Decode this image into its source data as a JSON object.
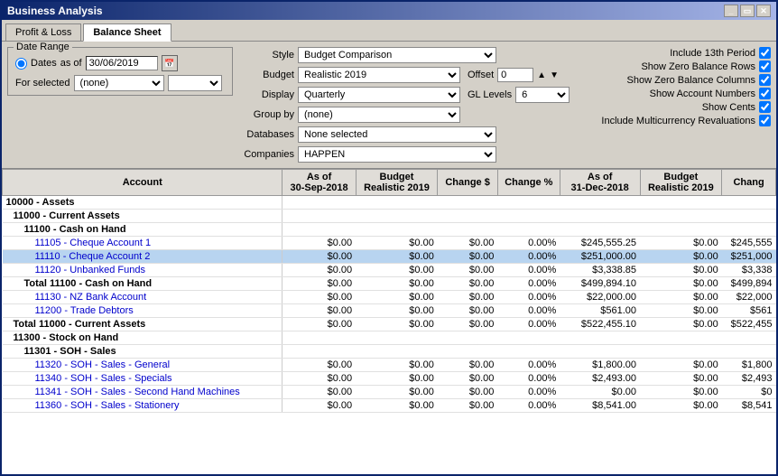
{
  "window": {
    "title": "Business Analysis"
  },
  "tabs": [
    {
      "label": "Profit & Loss",
      "active": false
    },
    {
      "label": "Balance Sheet",
      "active": true
    }
  ],
  "controls": {
    "dateRange": {
      "legend": "Date Range",
      "radioLabel": "Dates",
      "asOfLabel": "as of",
      "dateValue": "30/06/2019",
      "forSelectedLabel": "For selected",
      "forSelectedOption": "(none)"
    },
    "style": {
      "label": "Style",
      "value": "Budget Comparison"
    },
    "budget": {
      "label": "Budget",
      "value": "Realistic 2019"
    },
    "offset": {
      "label": "Offset",
      "value": "0"
    },
    "display": {
      "label": "Display",
      "value": "Quarterly"
    },
    "glLevels": {
      "label": "GL Levels",
      "value": "6"
    },
    "groupBy": {
      "label": "Group by",
      "value": "(none)"
    },
    "databases": {
      "label": "Databases",
      "value": "None selected"
    },
    "companies": {
      "label": "Companies",
      "value": "HAPPEN"
    }
  },
  "checkboxes": [
    {
      "label": "Include 13th Period",
      "checked": true
    },
    {
      "label": "Show Zero Balance Rows",
      "checked": true
    },
    {
      "label": "Show Zero Balance Columns",
      "checked": true
    },
    {
      "label": "Show Account Numbers",
      "checked": true
    },
    {
      "label": "Show Cents",
      "checked": true
    },
    {
      "label": "Include Multicurrency Revaluations",
      "checked": true
    }
  ],
  "table": {
    "col1Header": "Account",
    "columns": [
      {
        "header": "As of\n30-Sep-2018"
      },
      {
        "header": "Budget\nRealistic 2019"
      },
      {
        "header": "Change $"
      },
      {
        "header": "Change %"
      },
      {
        "header": "As of\n31-Dec-2018"
      },
      {
        "header": "Budget\nRealistic 2019"
      },
      {
        "header": "Chang"
      }
    ],
    "rows": [
      {
        "account": "10000 - Assets",
        "indent": 0,
        "bold": true,
        "values": [
          "",
          "",
          "",
          "",
          "",
          "",
          ""
        ]
      },
      {
        "account": "11000 - Current Assets",
        "indent": 1,
        "bold": true,
        "values": [
          "",
          "",
          "",
          "",
          "",
          "",
          ""
        ]
      },
      {
        "account": "11100 - Cash on Hand",
        "indent": 2,
        "bold": true,
        "values": [
          "",
          "",
          "",
          "",
          "",
          "",
          ""
        ]
      },
      {
        "account": "11105 - Cheque Account 1",
        "indent": 3,
        "bold": false,
        "link": true,
        "values": [
          "$0.00",
          "$0.00",
          "$0.00",
          "0.00%",
          "$245,555.25",
          "$0.00",
          "$245,555"
        ]
      },
      {
        "account": "11110 - Cheque Account 2",
        "indent": 3,
        "bold": false,
        "link": true,
        "highlight": true,
        "values": [
          "$0.00",
          "$0.00",
          "$0.00",
          "0.00%",
          "$251,000.00",
          "$0.00",
          "$251,000"
        ]
      },
      {
        "account": "11120 - Unbanked Funds",
        "indent": 3,
        "bold": false,
        "link": true,
        "values": [
          "$0.00",
          "$0.00",
          "$0.00",
          "0.00%",
          "$3,338.85",
          "$0.00",
          "$3,338"
        ]
      },
      {
        "account": "Total 11100 - Cash on Hand",
        "indent": 2,
        "bold": true,
        "values": [
          "$0.00",
          "$0.00",
          "$0.00",
          "0.00%",
          "$499,894.10",
          "$0.00",
          "$499,894"
        ]
      },
      {
        "account": "11130 - NZ Bank Account",
        "indent": 3,
        "bold": false,
        "link": true,
        "values": [
          "$0.00",
          "$0.00",
          "$0.00",
          "0.00%",
          "$22,000.00",
          "$0.00",
          "$22,000"
        ]
      },
      {
        "account": "11200 - Trade Debtors",
        "indent": 3,
        "bold": false,
        "link": true,
        "values": [
          "$0.00",
          "$0.00",
          "$0.00",
          "0.00%",
          "$561.00",
          "$0.00",
          "$561"
        ]
      },
      {
        "account": "Total 11000 - Current Assets",
        "indent": 1,
        "bold": true,
        "values": [
          "$0.00",
          "$0.00",
          "$0.00",
          "0.00%",
          "$522,455.10",
          "$0.00",
          "$522,455"
        ]
      },
      {
        "account": "11300 - Stock on Hand",
        "indent": 1,
        "bold": true,
        "values": [
          "",
          "",
          "",
          "",
          "",
          "",
          ""
        ]
      },
      {
        "account": "11301 - SOH - Sales",
        "indent": 2,
        "bold": true,
        "values": [
          "",
          "",
          "",
          "",
          "",
          "",
          ""
        ]
      },
      {
        "account": "11320 - SOH - Sales - General",
        "indent": 3,
        "bold": false,
        "link": true,
        "values": [
          "$0.00",
          "$0.00",
          "$0.00",
          "0.00%",
          "$1,800.00",
          "$0.00",
          "$1,800"
        ]
      },
      {
        "account": "11340 - SOH - Sales - Specials",
        "indent": 3,
        "bold": false,
        "link": true,
        "values": [
          "$0.00",
          "$0.00",
          "$0.00",
          "0.00%",
          "$2,493.00",
          "$0.00",
          "$2,493"
        ]
      },
      {
        "account": "11341 - SOH - Sales - Second Hand Machines",
        "indent": 3,
        "bold": false,
        "link": true,
        "values": [
          "$0.00",
          "$0.00",
          "$0.00",
          "0.00%",
          "$0.00",
          "$0.00",
          "$0"
        ]
      },
      {
        "account": "11360 - SOH - Sales - Stationery",
        "indent": 3,
        "bold": false,
        "link": true,
        "values": [
          "$0.00",
          "$0.00",
          "$0.00",
          "0.00%",
          "$8,541.00",
          "$0.00",
          "$8,541"
        ]
      }
    ]
  }
}
